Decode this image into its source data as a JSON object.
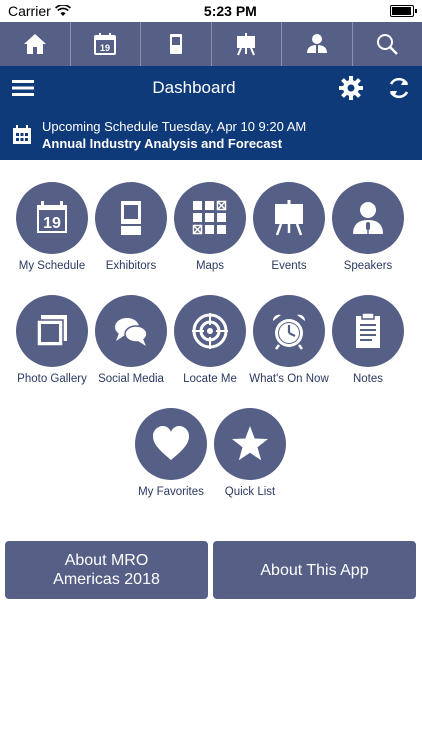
{
  "status_bar": {
    "carrier": "Carrier",
    "time": "5:23 PM",
    "battery_level": 0.95
  },
  "top_nav": {
    "icons": [
      "home-icon",
      "calendar-icon",
      "exhibitor-icon",
      "events-icon",
      "speaker-icon",
      "search-icon"
    ],
    "calendar_day": "19"
  },
  "header": {
    "title": "Dashboard"
  },
  "schedule": {
    "line1": "Upcoming Schedule Tuesday, Apr 10 9:20 AM",
    "line2": "Annual Industry Analysis and Forecast"
  },
  "tiles": [
    {
      "label": "My Schedule",
      "icon": "calendar-icon"
    },
    {
      "label": "Exhibitors",
      "icon": "exhibitor-booth-icon"
    },
    {
      "label": "Maps",
      "icon": "map-grid-icon"
    },
    {
      "label": "Events",
      "icon": "easel-icon"
    },
    {
      "label": "Speakers",
      "icon": "speaker-icon"
    },
    {
      "label": "Photo Gallery",
      "icon": "photos-icon"
    },
    {
      "label": "Social Media",
      "icon": "chat-bubbles-icon"
    },
    {
      "label": "Locate Me",
      "icon": "target-icon"
    },
    {
      "label": "What's On Now",
      "icon": "alarm-clock-icon"
    },
    {
      "label": "Notes",
      "icon": "clipboard-icon"
    },
    {
      "label": "My Favorites",
      "icon": "heart-icon"
    },
    {
      "label": "Quick List",
      "icon": "star-icon"
    }
  ],
  "bottom_buttons": {
    "about_mro": "About MRO Americas 2018",
    "about_app": "About This App"
  },
  "colors": {
    "navy": "#0f3a7a",
    "slate": "#565f86"
  }
}
